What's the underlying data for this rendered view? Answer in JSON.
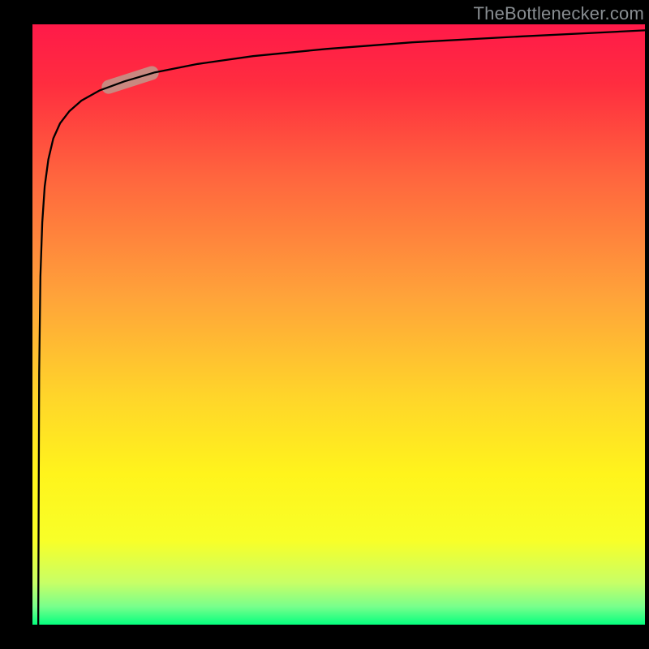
{
  "watermark": "TheBottlenecker.com",
  "chart_data": {
    "type": "line",
    "title": "",
    "xlabel": "",
    "ylabel": "",
    "xlim": [
      0,
      100
    ],
    "ylim": [
      0,
      100
    ],
    "background_gradient": {
      "stops": [
        {
          "pos": 0.0,
          "color": "#ff1a49"
        },
        {
          "pos": 0.1,
          "color": "#ff2d3f"
        },
        {
          "pos": 0.25,
          "color": "#ff643e"
        },
        {
          "pos": 0.45,
          "color": "#ffa23a"
        },
        {
          "pos": 0.62,
          "color": "#ffd52a"
        },
        {
          "pos": 0.75,
          "color": "#fff41c"
        },
        {
          "pos": 0.86,
          "color": "#f8ff28"
        },
        {
          "pos": 0.93,
          "color": "#c8ff66"
        },
        {
          "pos": 0.97,
          "color": "#78ff8c"
        },
        {
          "pos": 1.0,
          "color": "#05ff7e"
        }
      ]
    },
    "series": [
      {
        "name": "curve",
        "x": [
          0.95,
          1.1,
          1.3,
          1.6,
          2.0,
          2.6,
          3.4,
          4.5,
          6.0,
          8.0,
          11.0,
          15.0,
          20.0,
          27.0,
          36.0,
          48.0,
          62.0,
          80.0,
          100.0
        ],
        "y": [
          3.0,
          42.0,
          58.0,
          67.0,
          73.0,
          77.5,
          81.0,
          83.5,
          85.5,
          87.3,
          89.0,
          90.5,
          92.0,
          93.4,
          94.7,
          95.9,
          97.0,
          98.0,
          99.0
        ]
      }
    ],
    "highlight_segment": {
      "x_start": 12.0,
      "x_end": 20.0,
      "note": "salmon oval marker on the curve"
    }
  }
}
